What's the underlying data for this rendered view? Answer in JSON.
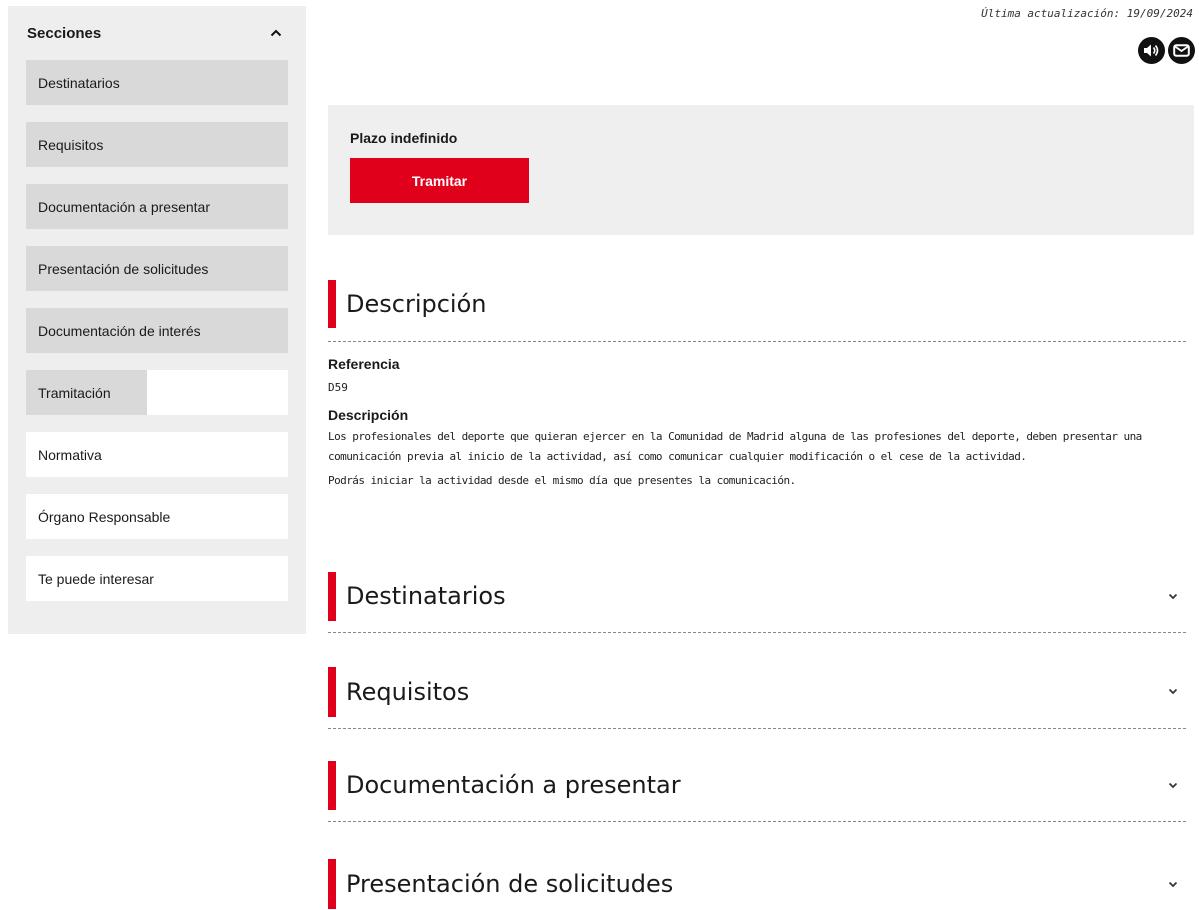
{
  "sidebar": {
    "title": "Secciones",
    "items": [
      {
        "label": "Destinatarios",
        "fill": 100
      },
      {
        "label": "Requisitos",
        "fill": 100
      },
      {
        "label": "Documentación a presentar",
        "fill": 100
      },
      {
        "label": "Presentación de solicitudes",
        "fill": 100
      },
      {
        "label": "Documentación de interés",
        "fill": 100
      },
      {
        "label": "Tramitación",
        "fill": 46
      },
      {
        "label": "Normativa",
        "fill": 0
      },
      {
        "label": "Órgano Responsable",
        "fill": 0
      },
      {
        "label": "Te puede interesar",
        "fill": 0
      }
    ]
  },
  "meta": {
    "last_updated": "Última actualización: 19/09/2024"
  },
  "icons": {
    "speaker": "speaker-icon",
    "mail": "mail-icon"
  },
  "deadline": {
    "label": "Plazo indefinido",
    "button": "Tramitar"
  },
  "description": {
    "title": "Descripción",
    "reference_heading": "Referencia",
    "reference_value": "D59",
    "description_heading": "Descripción",
    "paragraph_1": "Los profesionales del deporte que quieran ejercer en la Comunidad de Madrid alguna de las profesiones del deporte, deben presentar una comunicación previa al inicio de la actividad, así como comunicar cualquier modificación o el cese de la actividad.",
    "paragraph_2": "Podrás iniciar la actividad desde el mismo día que presentes la comunicación."
  },
  "sections": [
    {
      "title": "Destinatarios"
    },
    {
      "title": "Requisitos"
    },
    {
      "title": "Documentación a presentar"
    },
    {
      "title": "Presentación de solicitudes"
    }
  ],
  "colors": {
    "accent": "#e0001b",
    "sidebar_bg": "#eeeeee",
    "item_fill": "#d9d9d9"
  }
}
